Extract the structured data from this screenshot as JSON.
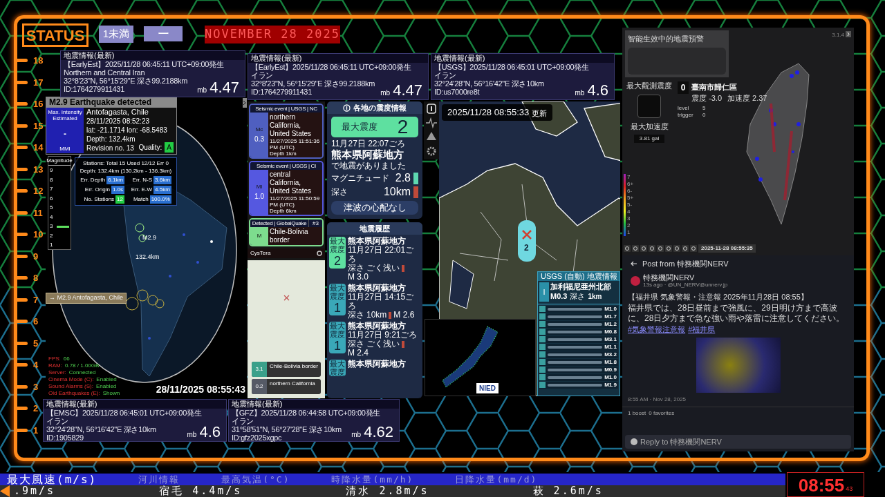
{
  "header": {
    "status": "STATUS",
    "intensity": "1未満",
    "level": "一",
    "date": "NOVEMBER 28 2025"
  },
  "ruler": [
    "18",
    "17",
    "16",
    "15",
    "14",
    "13",
    "12",
    "11",
    "10",
    "9",
    "8",
    "7",
    "6",
    "5",
    "4",
    "3",
    "2",
    "1"
  ],
  "quake_cards": [
    {
      "title": "地震情報(最新)",
      "lines": [
        "【EarlyEst】2025/11/28 06:45:11 UTC+09:00発生",
        "Northern and Central Iran",
        "32°8'23\"N, 56°15'29\"E 深さ99.2188km",
        "ID:1764279911431"
      ],
      "mag_type": "mb",
      "magnitude": "4.47"
    },
    {
      "title": "地震情報(最新)",
      "lines": [
        "【EarlyEst】2025/11/28 06:45:11 UTC+09:00発生",
        "イラン",
        "32°8'23\"N, 56°15'29\"E 深さ99.2188km",
        "ID:1764279911431"
      ],
      "mag_type": "mb",
      "magnitude": "4.47"
    },
    {
      "title": "地震情報(最新)",
      "lines": [
        "【USGS】2025/11/28 06:45:01 UTC+09:00発生",
        "イラン",
        "32°24'28\"N, 56°16'42\"E 深さ10km",
        "ID:us7000re8t"
      ],
      "mag_type": "mb",
      "magnitude": "4.6"
    },
    {
      "title": "地震情報(最新)",
      "lines": [
        "【EMSC】2025/11/28 06:45:01 UTC+09:00発生",
        "イラン",
        "32°24'28\"N, 56°16'42\"E 深さ10km",
        "ID:1905829"
      ],
      "mag_type": "mb",
      "magnitude": "4.6"
    },
    {
      "title": "地震情報(最新)",
      "lines": [
        "【GFZ】2025/11/28 06:44:58 UTC+09:00発生",
        "イラン",
        "31°58'51\"N, 56°27'28\"E 深さ10km",
        "ID:gfz2025xgpc"
      ],
      "mag_type": "mb",
      "magnitude": "4.62"
    }
  ],
  "globe": {
    "alert_title": "M2.9 Earthquake detected",
    "intensity_label": "Max. Intensity Estimated",
    "intensity_value": "-",
    "intensity_scale": "MMI",
    "details": [
      "Antofagasta, Chile",
      "28/11/2025 08:52:23",
      "lat: -21.1714 lon: -68.5483",
      "Depth: 132.4km",
      "Revision no. 13"
    ],
    "quality_label": "Quality:",
    "quality": "A",
    "stats": {
      "lines": [
        "Stations: Total 15 Used 12/12 Err 0",
        "Depth: 132.4km (130.2km - 136.3km)"
      ],
      "pairs": [
        {
          "label": "Err. Depth",
          "value": "6.1km",
          "color": "#2a6fd0"
        },
        {
          "label": "Err. N-S",
          "value": "3.6km",
          "color": "#2a6fd0"
        },
        {
          "label": "Err. Origin",
          "value": "1.0s",
          "color": "#2a6fd0"
        },
        {
          "label": "Err. E-W",
          "value": "4.5km",
          "color": "#2a6fd0"
        },
        {
          "label": "No. Stations",
          "value": "12",
          "color": "#22cc44"
        },
        {
          "label": "Match",
          "value": "100.0%",
          "color": "#2a6fd0"
        }
      ]
    },
    "meter_label": "Magnitude",
    "meter_ticks": [
      "9",
      "8",
      "7",
      "6",
      "5",
      "4",
      "3",
      "2",
      "1"
    ],
    "map_labels": [
      "M2.9",
      "132.4km"
    ],
    "event_label": "→ M2.9 Antofagasta, Chile",
    "debug": [
      {
        "label": "FPS:",
        "value": "66"
      },
      {
        "label": "RAM:",
        "value": "0.78 / 1.00GB"
      },
      {
        "label": "Server:",
        "value": "Connected"
      },
      {
        "label": "Cinema Mode (C):",
        "value": "Enabled"
      },
      {
        "label": "Sound Alarms (S):",
        "value": "Enabled"
      },
      {
        "label": "Old Earthquakes (E):",
        "value": "Shown"
      }
    ],
    "timestamp": "28/11/2025 08:55:43"
  },
  "event_list": {
    "events": [
      {
        "header": "Seismic event | USGS | NC",
        "mag_type": "Mc",
        "magnitude": "0.3",
        "place": "northern California, United States",
        "time": "11/27/2025 11:51:36 PM (UTC)",
        "depth": "Depth 1km",
        "color": "#4f5fc0"
      },
      {
        "header": "Seismic event | USGS | CI",
        "mag_type": "Ml",
        "magnitude": "1.0",
        "place": "central California, United States",
        "time": "11/27/2025 11:50:59 PM (UTC)",
        "depth": "Depth 6km",
        "color": "#5558e0"
      },
      {
        "header": "Detected | GlobalQuake",
        "number": "#3",
        "mag_type": "M",
        "place": "Chile-Bolivia border",
        "color": "#7ddc8e"
      }
    ],
    "app_name": "CysTera",
    "mini_cards": [
      {
        "magnitude": "3.1",
        "place": "Chile-Bolivia border",
        "color": "#3aa08a"
      },
      {
        "magnitude": "0.2",
        "place": "northern California",
        "color": "#555a66"
      }
    ]
  },
  "shindo": {
    "header": "各地の震度情報",
    "max_label": "最大震度",
    "max_value": "2",
    "time": "11月27日 22:07ごろ",
    "place": "熊本県阿蘇地方",
    "note": "で地震がありました",
    "rows": [
      {
        "label": "マグニチュード",
        "value": "2.8",
        "color": "#5ed8b0"
      },
      {
        "label": "深さ",
        "value": "10km",
        "color": "#c04a3a"
      }
    ],
    "tsunami": "津波の心配なし",
    "history_header": "地震履歴",
    "history": [
      {
        "badge_label": "最大震度",
        "intensity": "2",
        "place": "熊本県阿蘇地方",
        "time": "11月27日 22:01ごろ",
        "depth_label": "深さ",
        "depth": "ごく浅い",
        "magnitude": "M 3.0",
        "color": "#5ee0a0"
      },
      {
        "badge_label": "最大震度",
        "intensity": "1",
        "place": "熊本県阿蘇地方",
        "time": "11月27日 14:15ごろ",
        "depth_label": "深さ",
        "depth": "10km",
        "magnitude": "M 2.6",
        "color": "#3aa8b8"
      },
      {
        "badge_label": "最大震度",
        "intensity": "1",
        "place": "熊本県阿蘇地方",
        "time": "11月27日 9:21ごろ",
        "depth_label": "深さ",
        "depth": "ごく浅い",
        "magnitude": "M 2.4",
        "color": "#3aa8b8"
      },
      {
        "badge_label": "最大震度",
        "place": "熊本県阿蘇地方",
        "color": "#3aa8b8"
      }
    ]
  },
  "japan_map": {
    "time": "2025/11/28 08:55:33",
    "update_label": "更新",
    "epicenter_intensity": "2"
  },
  "nied": {
    "logo": "NIED"
  },
  "usgs": {
    "header": "USGS (自動) 地震情報",
    "top": {
      "intensity": "I",
      "place": "加利福尼亜州北部",
      "magnitude": "M0.3",
      "depth_label": "深さ",
      "depth": "1km"
    },
    "items": [
      "M1.0",
      "M1.7",
      "M1.2",
      "M0.8",
      "M3.1",
      "M1.1",
      "M3.2",
      "M1.8",
      "M0.9",
      "M1.0",
      "M1.9"
    ]
  },
  "taiwan": {
    "warning_title": "智能生效中的地震預警",
    "max_intensity_label": "最大觀測震度",
    "station_intensity": "0",
    "station": "臺南市歸仁區",
    "station_values": [
      "震度 -3.0",
      "加速度 2.37"
    ],
    "level_rows": [
      {
        "label": "level",
        "value": "5"
      },
      {
        "label": "trigger",
        "value": "0"
      }
    ],
    "max_accel_label": "最大加速度",
    "max_accel": "3.81 gal",
    "version": "3.1.4",
    "scale": [
      "7",
      "6+",
      "6-",
      "5+",
      "5-",
      "4",
      "3",
      "2",
      "1"
    ],
    "timestamp": "2025-11-28 08:55:35"
  },
  "post": {
    "header": "Post from 特務機関NERV",
    "author": "特務機関NERV",
    "meta": "13s ago · @UN_NERV@unnerv.jp",
    "title": "【福井県 気象警報・注意報 2025年11月28日 08:55】",
    "body": "福井県では、28日昼前まで強風に、29日明け方まで高波に、28日夕方まで急な強い雨や落雷に注意してください。",
    "hashtags": [
      "#気象警報注意報",
      "#福井県"
    ],
    "date": "8:55 AM · Nov 28, 2025",
    "stats": [
      "1 boost",
      "0 favorites"
    ],
    "reply": "Reply to 特務機関NERV"
  },
  "ticker": {
    "headings": [
      {
        "text": "最大風速(m/s)",
        "selected": true
      },
      {
        "text": "河川情報",
        "selected": false
      },
      {
        "text": "最高気温(°C)",
        "selected": false
      },
      {
        "text": "時降水量(mm/h)",
        "selected": false
      },
      {
        "text": "日降水量(mm/d)",
        "selected": false
      }
    ],
    "values": [
      ".9m/s",
      "宿毛 4.4m/s",
      "清水 2.8m/s",
      "萩 2.6m/s"
    ],
    "clock": "08:55",
    "clock_small": "43"
  }
}
